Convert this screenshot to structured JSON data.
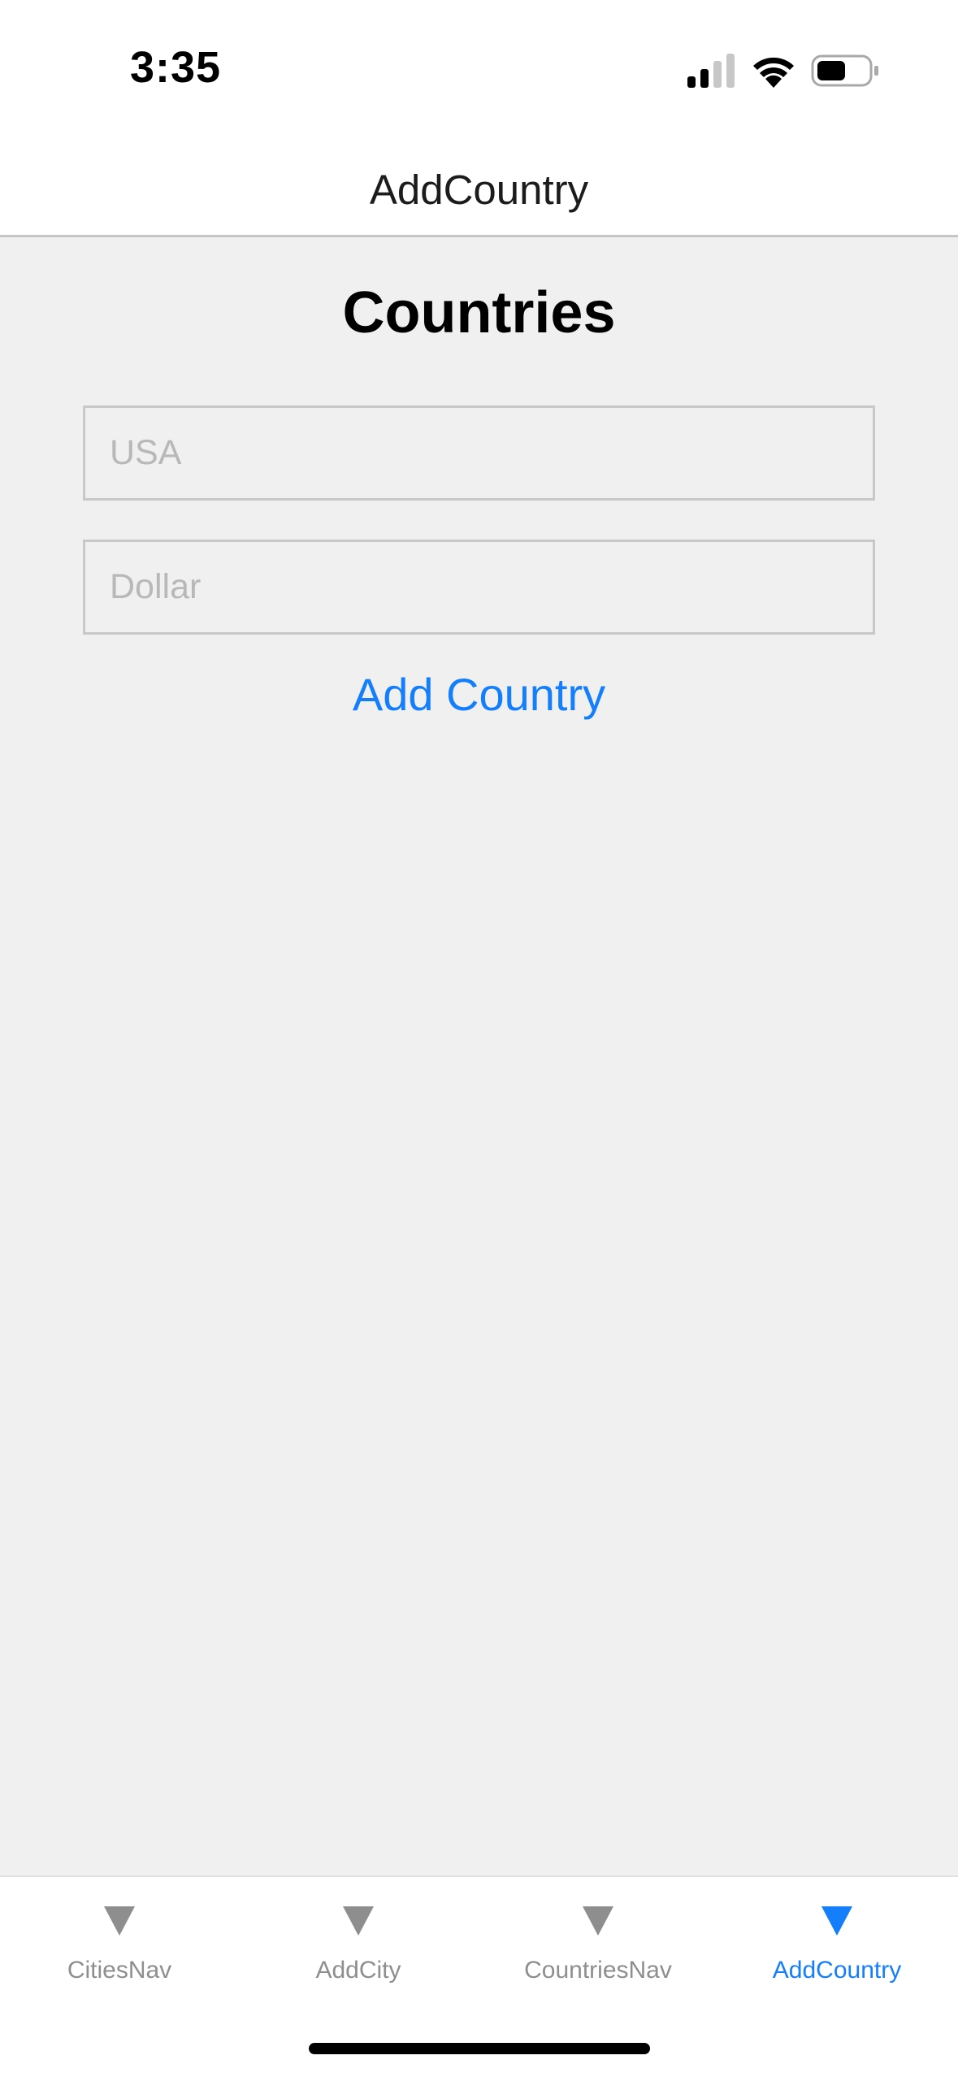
{
  "status_bar": {
    "time": "3:35",
    "icons": [
      "signal-icon",
      "wifi-icon",
      "battery-icon"
    ]
  },
  "nav_bar": {
    "title": "AddCountry"
  },
  "main": {
    "heading": "Countries",
    "country_field": {
      "value": "",
      "placeholder": "USA"
    },
    "currency_field": {
      "value": "",
      "placeholder": "Dollar"
    },
    "add_button_label": "Add Country"
  },
  "tab_bar": {
    "tabs": [
      {
        "label": "CitiesNav",
        "icon": "triangle-down-icon",
        "active": false
      },
      {
        "label": "AddCity",
        "icon": "triangle-down-icon",
        "active": false
      },
      {
        "label": "CountriesNav",
        "icon": "triangle-down-icon",
        "active": false
      },
      {
        "label": "AddCountry",
        "icon": "triangle-down-icon",
        "active": true
      }
    ]
  },
  "colors": {
    "accent": "#147efb",
    "inactive_tab": "#8e8e8e",
    "background": "#f0f0f0",
    "bar_background": "#ffffff"
  }
}
